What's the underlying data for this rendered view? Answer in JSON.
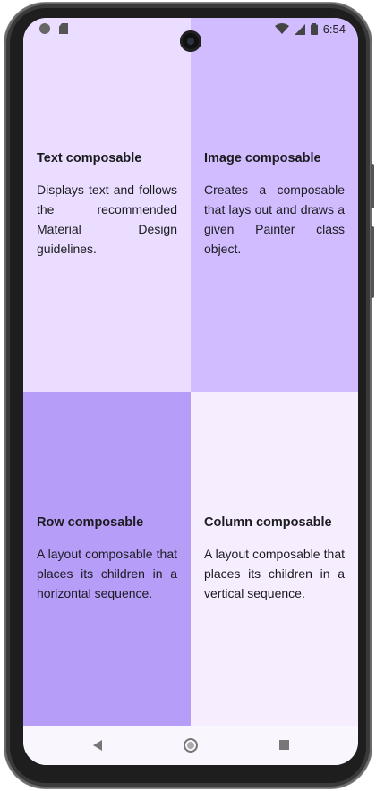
{
  "status_bar": {
    "time": "6:54",
    "left_icons": [
      "notification-dot-icon",
      "sd-card-icon"
    ],
    "right_icons": [
      "wifi-icon",
      "signal-icon",
      "battery-icon"
    ]
  },
  "quadrants": [
    {
      "title": "Text composable",
      "description": "Displays text and follows the recommended Material Design guidelines.",
      "background": "#EADDFF"
    },
    {
      "title": "Image composable",
      "description": "Creates a composable that lays out and draws a given Painter class object.",
      "background": "#D0BCFF"
    },
    {
      "title": "Row composable",
      "description": "A layout composable that places its children in a horizontal sequence.",
      "background": "#B69DF8"
    },
    {
      "title": "Column composable",
      "description": "A layout composable that places its children in a vertical sequence.",
      "background": "#F6EDFF"
    }
  ],
  "nav_bar": {
    "icons": [
      "back-icon",
      "home-icon",
      "recents-icon"
    ]
  }
}
